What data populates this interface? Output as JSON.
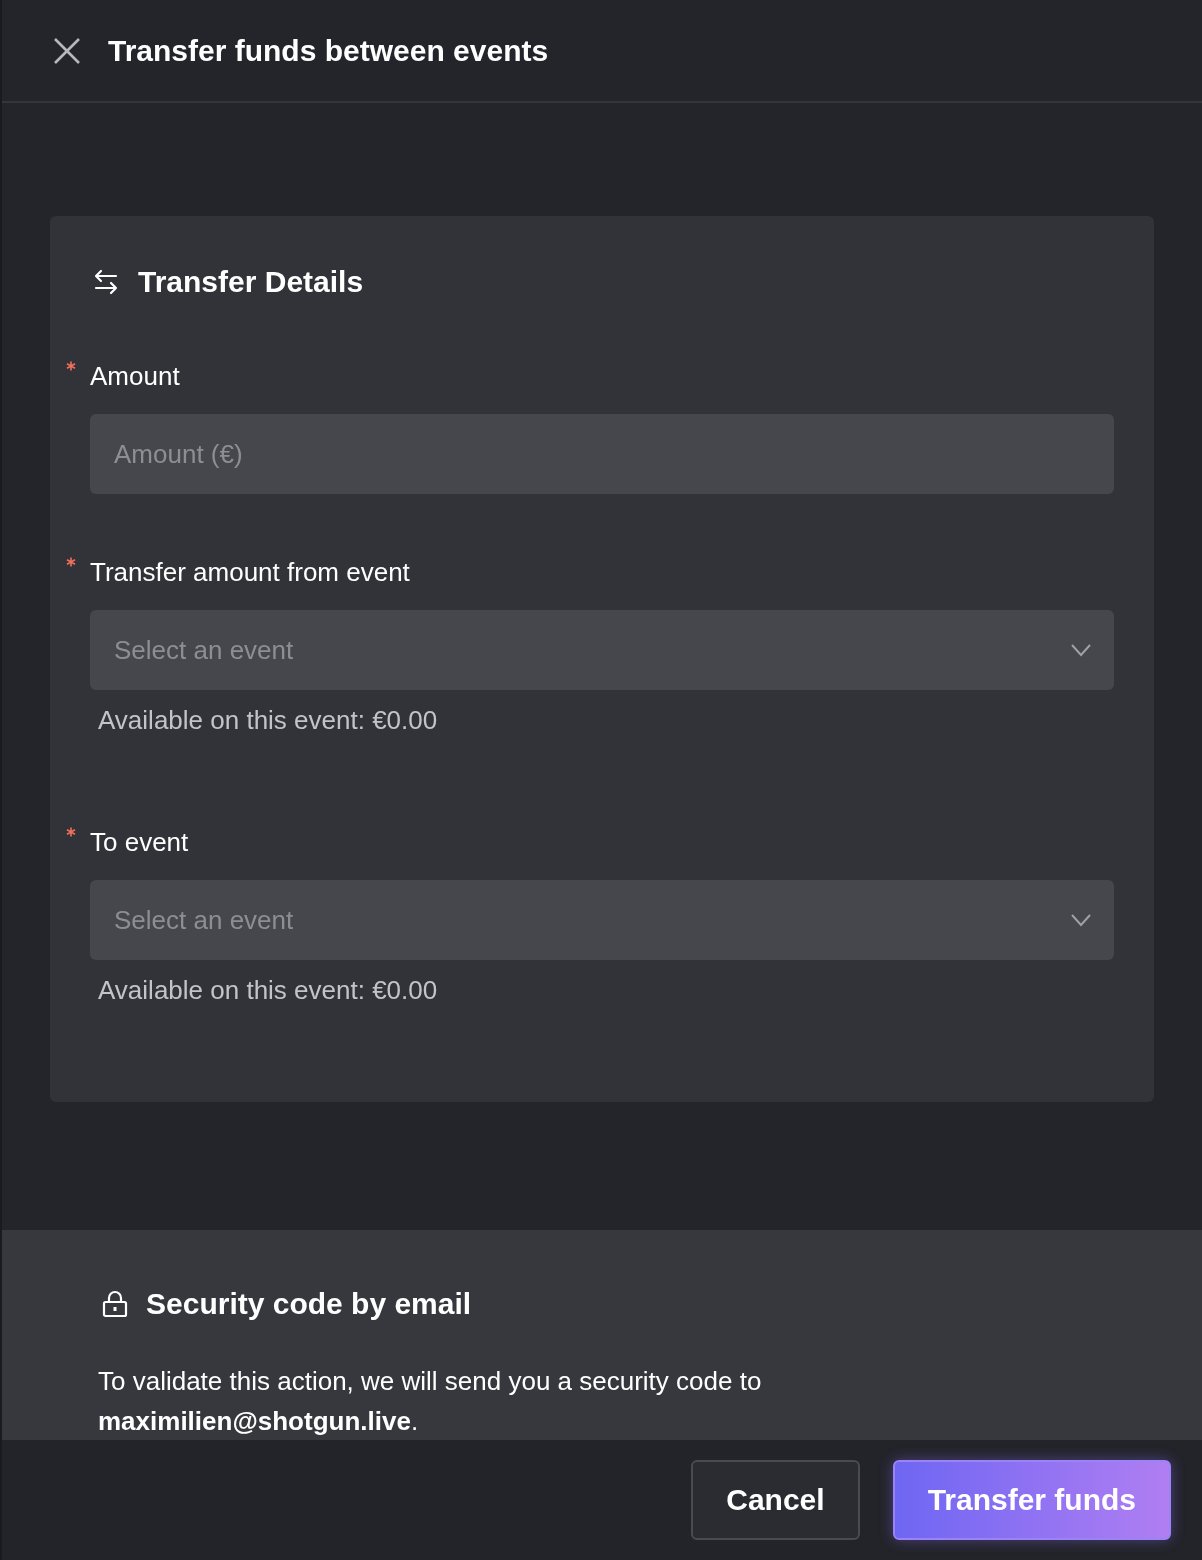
{
  "header": {
    "title": "Transfer funds between events"
  },
  "card": {
    "title": "Transfer Details",
    "fields": [
      {
        "kind": "input",
        "label": "Amount",
        "required": true,
        "placeholder": "Amount (€)"
      },
      {
        "kind": "select",
        "label": "Transfer amount from event",
        "required": true,
        "placeholder": "Select an event",
        "helper": "Available on this event: €0.00"
      },
      {
        "kind": "select",
        "label": "To event",
        "required": true,
        "placeholder": "Select an event",
        "helper": "Available on this event: €0.00"
      }
    ]
  },
  "security": {
    "title": "Security code by email",
    "message": "To validate this action, we will send you a security code to **maximilien@shotgun.live**."
  },
  "buttons": [
    {
      "label": "Cancel",
      "kind": "secondary"
    },
    {
      "label": "Transfer funds",
      "kind": "primary"
    }
  ]
}
